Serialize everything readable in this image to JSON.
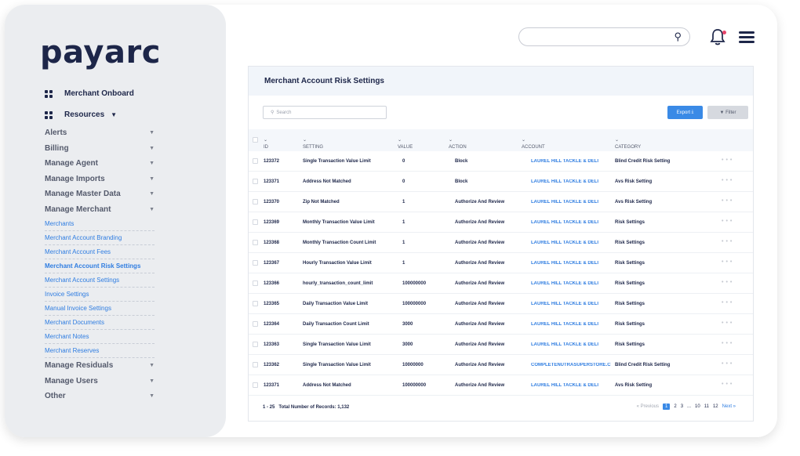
{
  "brand": {
    "logo": "payarc"
  },
  "sidebar": {
    "onboard_label": "Merchant Onboard",
    "resources_label": "Resources",
    "menu": [
      {
        "label": "Alerts"
      },
      {
        "label": "Billing"
      },
      {
        "label": "Manage Agent"
      },
      {
        "label": "Manage Imports"
      },
      {
        "label": "Manage Master Data"
      },
      {
        "label": "Manage Merchant"
      }
    ],
    "submenu": [
      "Merchants",
      "Merchant Account Branding",
      "Merchant Account Fees",
      "Merchant Account Risk Settings",
      "Merchant Account Settings",
      "Invoice Settings",
      "Manual Invoice Settings",
      "Merchant Documents",
      "Merchant Notes",
      "Merchant Reserves"
    ],
    "active_submenu": "Merchant Account Risk Settings",
    "menu_after": [
      {
        "label": "Manage Residuals"
      },
      {
        "label": "Manage Users"
      },
      {
        "label": "Other"
      }
    ]
  },
  "panel": {
    "title": "Merchant Account Risk Settings",
    "search_placeholder": "Search",
    "export_label": "Export",
    "filter_label": "Filter"
  },
  "table": {
    "headers": {
      "id": "ID",
      "setting": "SETTING",
      "value": "VALUE",
      "action": "ACTION",
      "account": "ACCOUNT",
      "category": "CATEGORY"
    },
    "rows": [
      {
        "id": "123372",
        "setting": "Single Transaction Value Limit",
        "value": "0",
        "action": "Block",
        "account": "LAUREL HILL TACKLE & DELI",
        "category": "Blind Credit Risk Setting"
      },
      {
        "id": "123371",
        "setting": "Address Not Matched",
        "value": "0",
        "action": "Block",
        "account": "LAUREL HILL TACKLE & DELI",
        "category": "Avs Risk Setting"
      },
      {
        "id": "123370",
        "setting": "Zip Not Matched",
        "value": "1",
        "action": "Authorize And Review",
        "account": "LAUREL HILL TACKLE & DELI",
        "category": "Avs Risk Setting"
      },
      {
        "id": "123369",
        "setting": "Monthly Transaction Value Limit",
        "value": "1",
        "action": "Authorize And Review",
        "account": "LAUREL HILL TACKLE & DELI",
        "category": "Risk Settings"
      },
      {
        "id": "123368",
        "setting": "Monthly Transaction Count Limit",
        "value": "1",
        "action": "Authorize And Review",
        "account": "LAUREL HILL TACKLE & DELI",
        "category": "Risk Settings"
      },
      {
        "id": "123367",
        "setting": "Hourly Transaction Value Limit",
        "value": "1",
        "action": "Authorize And Review",
        "account": "LAUREL HILL TACKLE & DELI",
        "category": "Risk Settings"
      },
      {
        "id": "123366",
        "setting": "hourly_transaction_count_limit",
        "value": "100000000",
        "action": "Authorize And Review",
        "account": "LAUREL HILL TACKLE & DELI",
        "category": "Risk Settings"
      },
      {
        "id": "123365",
        "setting": "Daily Transaction Value Limit",
        "value": "100000000",
        "action": "Authorize And Review",
        "account": "LAUREL HILL TACKLE & DELI",
        "category": "Risk Settings"
      },
      {
        "id": "123364",
        "setting": "Daily Transaction Count Limit",
        "value": "3000",
        "action": "Authorize And Review",
        "account": "LAUREL HILL TACKLE & DELI",
        "category": "Risk Settings"
      },
      {
        "id": "123363",
        "setting": "Single Transaction Value Limit",
        "value": "3000",
        "action": "Authorize And Review",
        "account": "LAUREL HILL TACKLE & DELI",
        "category": "Risk Settings"
      },
      {
        "id": "123362",
        "setting": "Single Transaction Value Limit",
        "value": "10000000",
        "action": "Authorize And Review",
        "account": "COMPLETENUTRASUPERSTORE.C",
        "category": "Blind Credit Risk Setting"
      },
      {
        "id": "123371",
        "setting": "Address Not Matched",
        "value": "100000000",
        "action": "Authorize And Review",
        "account": "LAUREL HILL TACKLE & DELI",
        "category": "Avs Risk Setting"
      }
    ]
  },
  "footer": {
    "range": "1 - 25",
    "total": "Total Number of Records: 1,132"
  },
  "pager": {
    "prev": "« Previous",
    "pages": [
      "1",
      "2",
      "3",
      "...",
      "10",
      "11",
      "12"
    ],
    "current": "1",
    "next": "Next »"
  }
}
